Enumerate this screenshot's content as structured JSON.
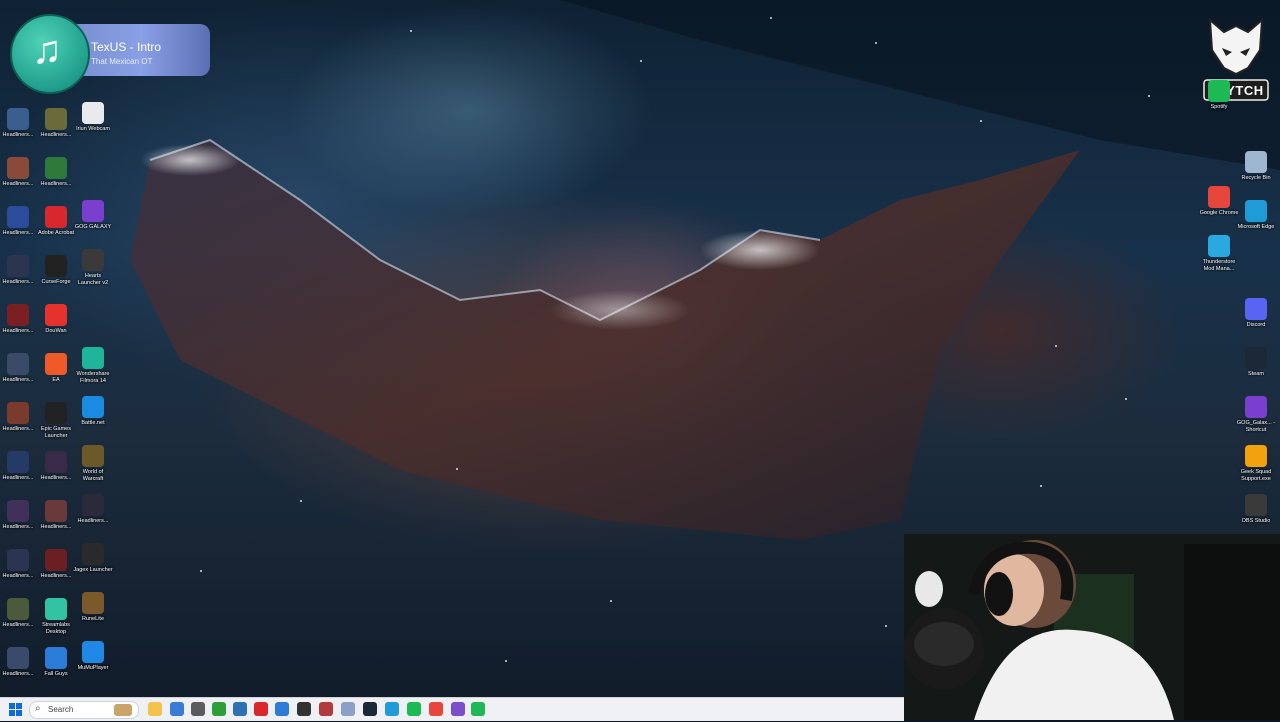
{
  "media_widget": {
    "title": "TexUS - Intro",
    "artist": "That Mexican OT",
    "icon": "music-note-icon"
  },
  "taskbar": {
    "search_placeholder": "Search",
    "pinned": [
      {
        "name": "taskbar-file-explorer",
        "color": "#f3c24a"
      },
      {
        "name": "taskbar-app-2",
        "color": "#3a7bd5"
      },
      {
        "name": "taskbar-app-3",
        "color": "#5b5b5b"
      },
      {
        "name": "taskbar-xbox",
        "color": "#2e9e3a"
      },
      {
        "name": "taskbar-app-5",
        "color": "#2f6fb3"
      },
      {
        "name": "taskbar-adobe",
        "color": "#d8282e"
      },
      {
        "name": "taskbar-app-7",
        "color": "#2d7bd6"
      },
      {
        "name": "taskbar-app-8",
        "color": "#333"
      },
      {
        "name": "taskbar-app-9",
        "color": "#b13b3b"
      },
      {
        "name": "taskbar-app-10",
        "color": "#8aa0c8"
      },
      {
        "name": "taskbar-steam",
        "color": "#1b2838"
      },
      {
        "name": "taskbar-edge",
        "color": "#1f9bd8"
      },
      {
        "name": "taskbar-spotify",
        "color": "#1db954"
      },
      {
        "name": "taskbar-chrome",
        "color": "#e8453c"
      },
      {
        "name": "taskbar-app-15",
        "color": "#7a4fc9"
      },
      {
        "name": "taskbar-app-16",
        "color": "#1db954"
      }
    ]
  },
  "desktop": {
    "col1": [
      {
        "label": "Headliners...",
        "color": "#3a5f8f"
      },
      {
        "label": "Headliners...",
        "color": "#8a4a3a"
      },
      {
        "label": "Headliners...",
        "color": "#2b4c9a"
      },
      {
        "label": "Headliners...",
        "color": "#2c3550"
      },
      {
        "label": "Headliners...",
        "color": "#7a1f22"
      },
      {
        "label": "Headliners...",
        "color": "#3b4a66"
      },
      {
        "label": "Headliners...",
        "color": "#7a3b2c"
      },
      {
        "label": "Headliners...",
        "color": "#253a66"
      },
      {
        "label": "Headliners...",
        "color": "#40305a"
      },
      {
        "label": "Headliners...",
        "color": "#2a3552"
      },
      {
        "label": "Headliners...",
        "color": "#4a5a3a"
      },
      {
        "label": "Headliners...",
        "color": "#3a4a6a"
      }
    ],
    "col2": [
      {
        "label": "Headliners...",
        "color": "#6a6a3a"
      },
      {
        "label": "Headliners...",
        "color": "#2f7a3a"
      },
      {
        "label": "Adobe Acrobat",
        "color": "#d8282e"
      },
      {
        "label": "CurseForge",
        "color": "#222"
      },
      {
        "label": "DouWan",
        "color": "#e5322d"
      },
      {
        "label": "EA",
        "color": "#f05a28"
      },
      {
        "label": "Epic Games Launcher",
        "color": "#222"
      },
      {
        "label": "Headliners...",
        "color": "#3a2a4a"
      },
      {
        "label": "Headliners...",
        "color": "#6a3a3a"
      },
      {
        "label": "Headliners...",
        "color": "#6a1f22"
      },
      {
        "label": "Streamlabs Desktop",
        "color": "#31c3a2"
      },
      {
        "label": "Fall Guys",
        "color": "#2b7bd8"
      }
    ],
    "col3": [
      {
        "label": "Iriun Webcam",
        "color": "#e8eaee"
      },
      {
        "label": "GOG GALAXY",
        "color": "#7b3fd0"
      },
      {
        "label": "Hearts Launcher v2",
        "color": "#3a3a3a"
      },
      {
        "label": "Wondershare Filmora 14",
        "color": "#1fb59a"
      },
      {
        "label": "Battle.net",
        "color": "#1a8be0"
      },
      {
        "label": "World of Warcraft",
        "color": "#6a5a2a"
      },
      {
        "label": "Headliners...",
        "color": "#2a2a3a"
      },
      {
        "label": "Jagex Launcher",
        "color": "#2a2a2a"
      },
      {
        "label": "RuneLite",
        "color": "#7a5a2a"
      },
      {
        "label": "MuMuPlayer",
        "color": "#1f88e5"
      }
    ],
    "right_col_a": [
      {
        "label": "Spotify",
        "color": "#1db954"
      },
      {
        "label": "Google Chrome",
        "color": "#e8453c"
      },
      {
        "label": "Thunderstore Mod Mana...",
        "color": "#2aa8e0"
      }
    ],
    "right_col_b": [
      {
        "label": "Recycle Bin",
        "color": "#9fb6d0"
      },
      {
        "label": "Microsoft Edge",
        "color": "#1f9bd8"
      },
      {
        "label": "Discord",
        "color": "#5865f2"
      },
      {
        "label": "Steam",
        "color": "#1b2838"
      },
      {
        "label": "GOG_Galax... - Shortcut",
        "color": "#7b3fd0"
      },
      {
        "label": "Geek Squad Support.exe",
        "color": "#f2a20c"
      },
      {
        "label": "OBS Studio",
        "color": "#3a3a3a"
      }
    ]
  },
  "logo": {
    "text": "GLYTCH",
    "icon": "fox-logo-icon"
  }
}
